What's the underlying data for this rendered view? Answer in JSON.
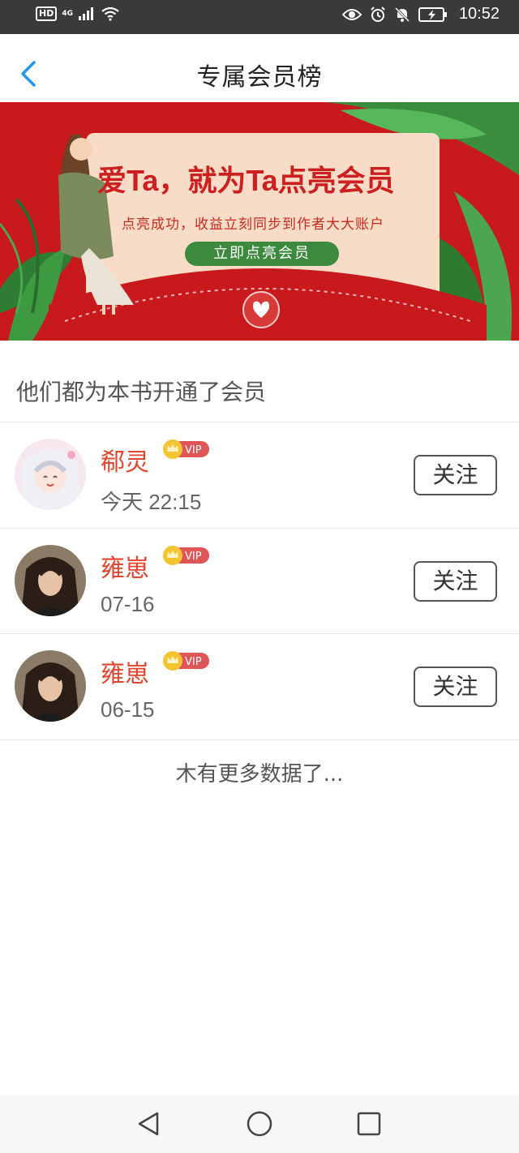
{
  "status_bar": {
    "hd_label": "HD",
    "network_label": "4G",
    "time": "10:52",
    "icons": [
      "signal-icon",
      "wifi-icon",
      "eye-icon",
      "alarm-icon",
      "mute-icon",
      "battery-icon"
    ]
  },
  "header": {
    "title": "专属会员榜",
    "back_icon": "chevron-left-icon"
  },
  "banner": {
    "headline": "爱Ta，就为Ta点亮会员",
    "subtitle": "点亮成功，收益立刻同步到作者大大账户",
    "cta_label": "立即点亮会员",
    "colors": {
      "background": "#c8191c",
      "card": "#f8dcc8",
      "cta": "#3d8a3f"
    }
  },
  "section_title": "他们都为本书开通了会员",
  "members": [
    {
      "name": "郗灵",
      "badge": "VIP",
      "date": "今天 22:15",
      "follow_label": "关注",
      "avatar": "anime-girl-avatar"
    },
    {
      "name": "雍崽",
      "badge": "VIP",
      "date": "07-16",
      "follow_label": "关注",
      "avatar": "girl-photo-avatar"
    },
    {
      "name": "雍崽",
      "badge": "VIP",
      "date": "06-15",
      "follow_label": "关注",
      "avatar": "girl-photo-avatar"
    }
  ],
  "footer_text": "木有更多数据了...",
  "nav_bar": {
    "icons": [
      "back-triangle-icon",
      "home-circle-icon",
      "recents-square-icon"
    ]
  },
  "accent_colors": {
    "name": "#e0452d",
    "back_arrow": "#2196f3",
    "vip_badge": "#e05555"
  }
}
